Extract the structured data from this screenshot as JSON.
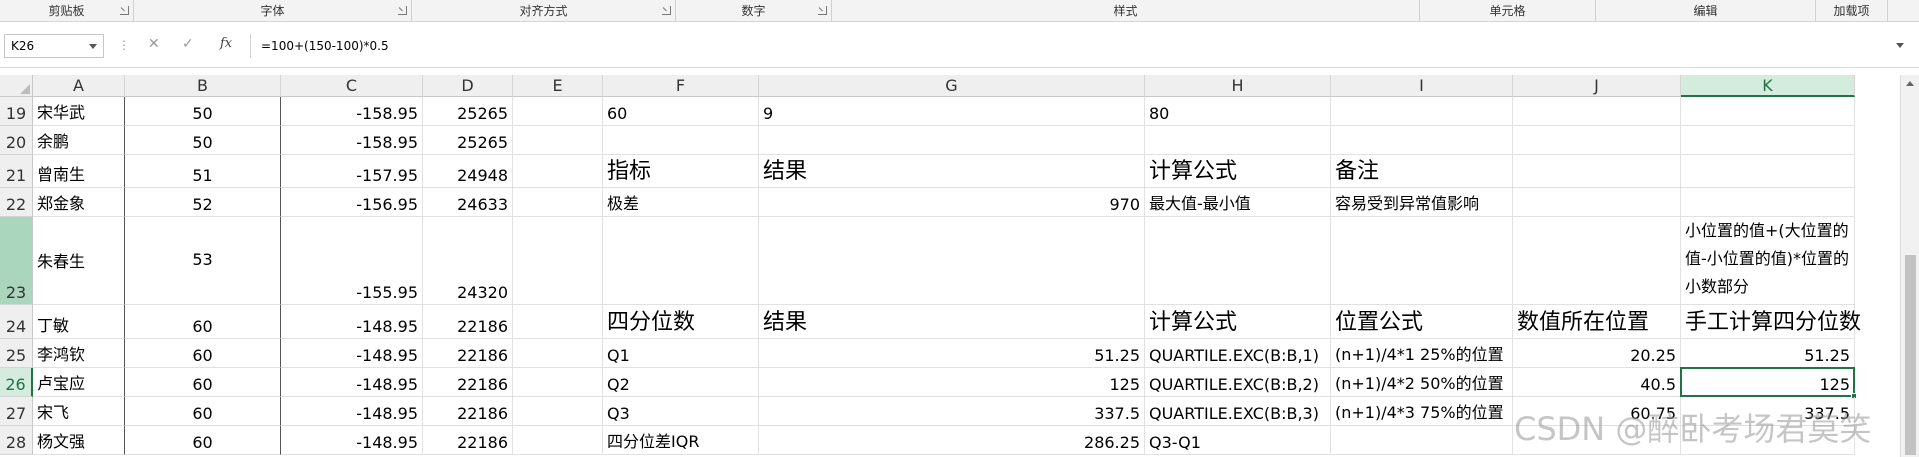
{
  "ribbon": {
    "groups": [
      "剪贴板",
      "字体",
      "对齐方式",
      "数字",
      "样式",
      "单元格",
      "编辑",
      "加载项"
    ]
  },
  "formula_bar": {
    "name_box": "K26",
    "formula": "=100+(150-100)*0.5",
    "fx": "fx",
    "cancel": "✕",
    "enter": "✓"
  },
  "columns": [
    "A",
    "B",
    "C",
    "D",
    "E",
    "F",
    "G",
    "H",
    "I",
    "J",
    "K"
  ],
  "rows": [
    {
      "num": "19",
      "A": "宋华武",
      "B": "50",
      "C": "-158.95",
      "D": "25265",
      "F": "60",
      "G": "9",
      "H": "80"
    },
    {
      "num": "20",
      "A": "余鹏",
      "B": "50",
      "C": "-158.95",
      "D": "25265"
    },
    {
      "num": "21",
      "A": "曾南生",
      "B": "51",
      "C": "-157.95",
      "D": "24948",
      "F": "指标",
      "G": "结果",
      "H": "计算公式",
      "I": "备注"
    },
    {
      "num": "22",
      "A": "郑金象",
      "B": "52",
      "C": "-156.95",
      "D": "24633",
      "F": "极差",
      "G": "970",
      "H": "最大值-最小值",
      "I": "容易受到异常值影响"
    },
    {
      "num": "23",
      "A": "朱春生",
      "B": "53",
      "C": "-155.95",
      "D": "24320",
      "K": "小位置的值+(大位置的值-小位置的值)*位置的小数部分"
    },
    {
      "num": "24",
      "A": "丁敏",
      "B": "60",
      "C": "-148.95",
      "D": "22186",
      "F": "四分位数",
      "G": "结果",
      "H": "计算公式",
      "I": "位置公式",
      "J": "数值所在位置",
      "K": "手工计算四分位数"
    },
    {
      "num": "25",
      "A": "李鸿钦",
      "B": "60",
      "C": "-148.95",
      "D": "22186",
      "F": "Q1",
      "G": "51.25",
      "H": "QUARTILE.EXC(B:B,1)",
      "I": "(n+1)/4*1  25%的位置",
      "J": "20.25",
      "K": "51.25"
    },
    {
      "num": "26",
      "A": "卢宝应",
      "B": "60",
      "C": "-148.95",
      "D": "22186",
      "F": "Q2",
      "G": "125",
      "H": "QUARTILE.EXC(B:B,2)",
      "I": "(n+1)/4*2  50%的位置",
      "J": "40.5",
      "K": "125"
    },
    {
      "num": "27",
      "A": "宋飞",
      "B": "60",
      "C": "-148.95",
      "D": "22186",
      "F": "Q3",
      "G": "337.5",
      "H": "QUARTILE.EXC(B:B,3)",
      "I": "(n+1)/4*3  75%的位置",
      "J": "60.75",
      "K": "337.5"
    },
    {
      "num": "28",
      "A": "杨文强",
      "B": "60",
      "C": "-148.95",
      "D": "22186",
      "F": "四分位差IQR",
      "G": "286.25",
      "H": "Q3-Q1"
    }
  ],
  "selected_cell": "K26",
  "watermark": "CSDN @醉卧考场君莫笑",
  "colors": {
    "accent": "#217346",
    "selected_header_bg": "#d3ecdd",
    "row23_header_bg": "#a9d6bd"
  }
}
